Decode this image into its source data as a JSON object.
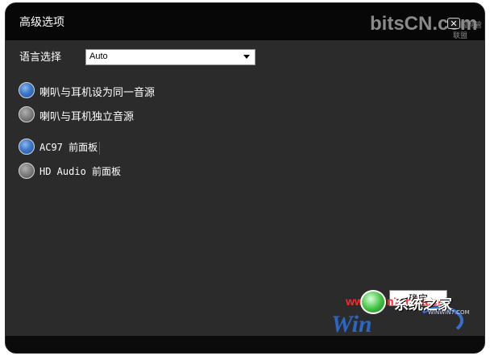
{
  "dialog": {
    "title": "高级选项",
    "close_symbol": "✕"
  },
  "watermark": {
    "top_text": "bitsCN.com",
    "top_sub": "中国网管联盟",
    "url": "www.win7zhijia.cn",
    "win_text": "Win",
    "logo_text": "系统之家",
    "logo_sub": "WINWIN7.COM"
  },
  "language": {
    "label": "语言选择",
    "selected": "Auto"
  },
  "audio_group": [
    {
      "label": "喇叭与耳机设为同一音源",
      "selected": true
    },
    {
      "label": "喇叭与耳机独立音源",
      "selected": false
    }
  ],
  "panel_group": [
    {
      "label": "AC97 前面板",
      "selected": true
    },
    {
      "label": "HD Audio 前面板",
      "selected": false
    }
  ],
  "ok_label": "确定",
  "colors": {
    "background": "#2b2b2b",
    "radio_on": "#3f78c8",
    "radio_off": "#7c7c7c",
    "watermark_red": "#ff2a2a"
  },
  "icons": [
    "close-icon",
    "dropdown-arrow-icon",
    "system-logo-icon"
  ]
}
